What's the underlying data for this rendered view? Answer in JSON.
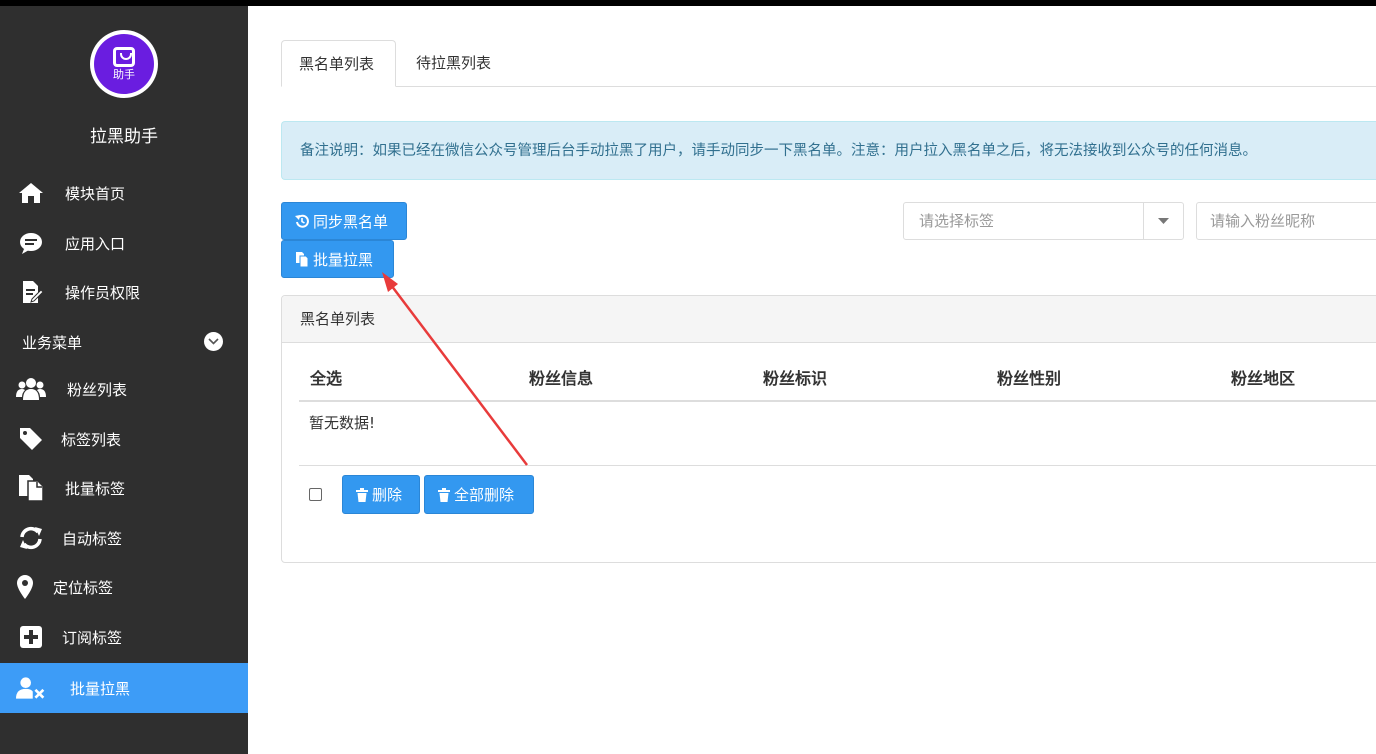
{
  "app": {
    "logo_text": "助手",
    "title": "拉黑助手"
  },
  "sidebar": {
    "items": [
      {
        "label": "模块首页",
        "icon": "home-icon"
      },
      {
        "label": "应用入口",
        "icon": "comment-icon"
      },
      {
        "label": "操作员权限",
        "icon": "edit-document-icon"
      }
    ],
    "section": {
      "label": "业务菜单",
      "icon": "chevron-down-icon"
    },
    "business_items": [
      {
        "label": "粉丝列表",
        "icon": "users-icon"
      },
      {
        "label": "标签列表",
        "icon": "tag-icon"
      },
      {
        "label": "批量标签",
        "icon": "copy-icon"
      },
      {
        "label": "自动标签",
        "icon": "refresh-icon"
      },
      {
        "label": "定位标签",
        "icon": "map-marker-icon"
      },
      {
        "label": "订阅标签",
        "icon": "plus-square-icon"
      },
      {
        "label": "批量拉黑",
        "icon": "user-remove-icon",
        "active": true
      }
    ]
  },
  "tabs": [
    {
      "label": "黑名单列表",
      "active": true
    },
    {
      "label": "待拉黑列表",
      "active": false
    }
  ],
  "notice": "备注说明：如果已经在微信公众号管理后台手动拉黑了用户，请手动同步一下黑名单。注意：用户拉入黑名单之后，将无法接收到公众号的任何消息。",
  "toolbar": {
    "sync_label": "同步黑名单",
    "batch_label": "批量拉黑",
    "tag_select_placeholder": "请选择标签",
    "search_placeholder": "请输入粉丝昵称"
  },
  "panel": {
    "title": "黑名单列表",
    "columns": [
      "全选",
      "粉丝信息",
      "粉丝标识",
      "粉丝性别",
      "粉丝地区"
    ],
    "empty_text": "暂无数据!",
    "delete_label": "删除",
    "delete_all_label": "全部删除"
  },
  "colors": {
    "sidebar_bg": "#2f2f2f",
    "accent": "#3398f0",
    "active_nav": "#3d9cf7",
    "annotation_arrow": "#e83b3b"
  }
}
